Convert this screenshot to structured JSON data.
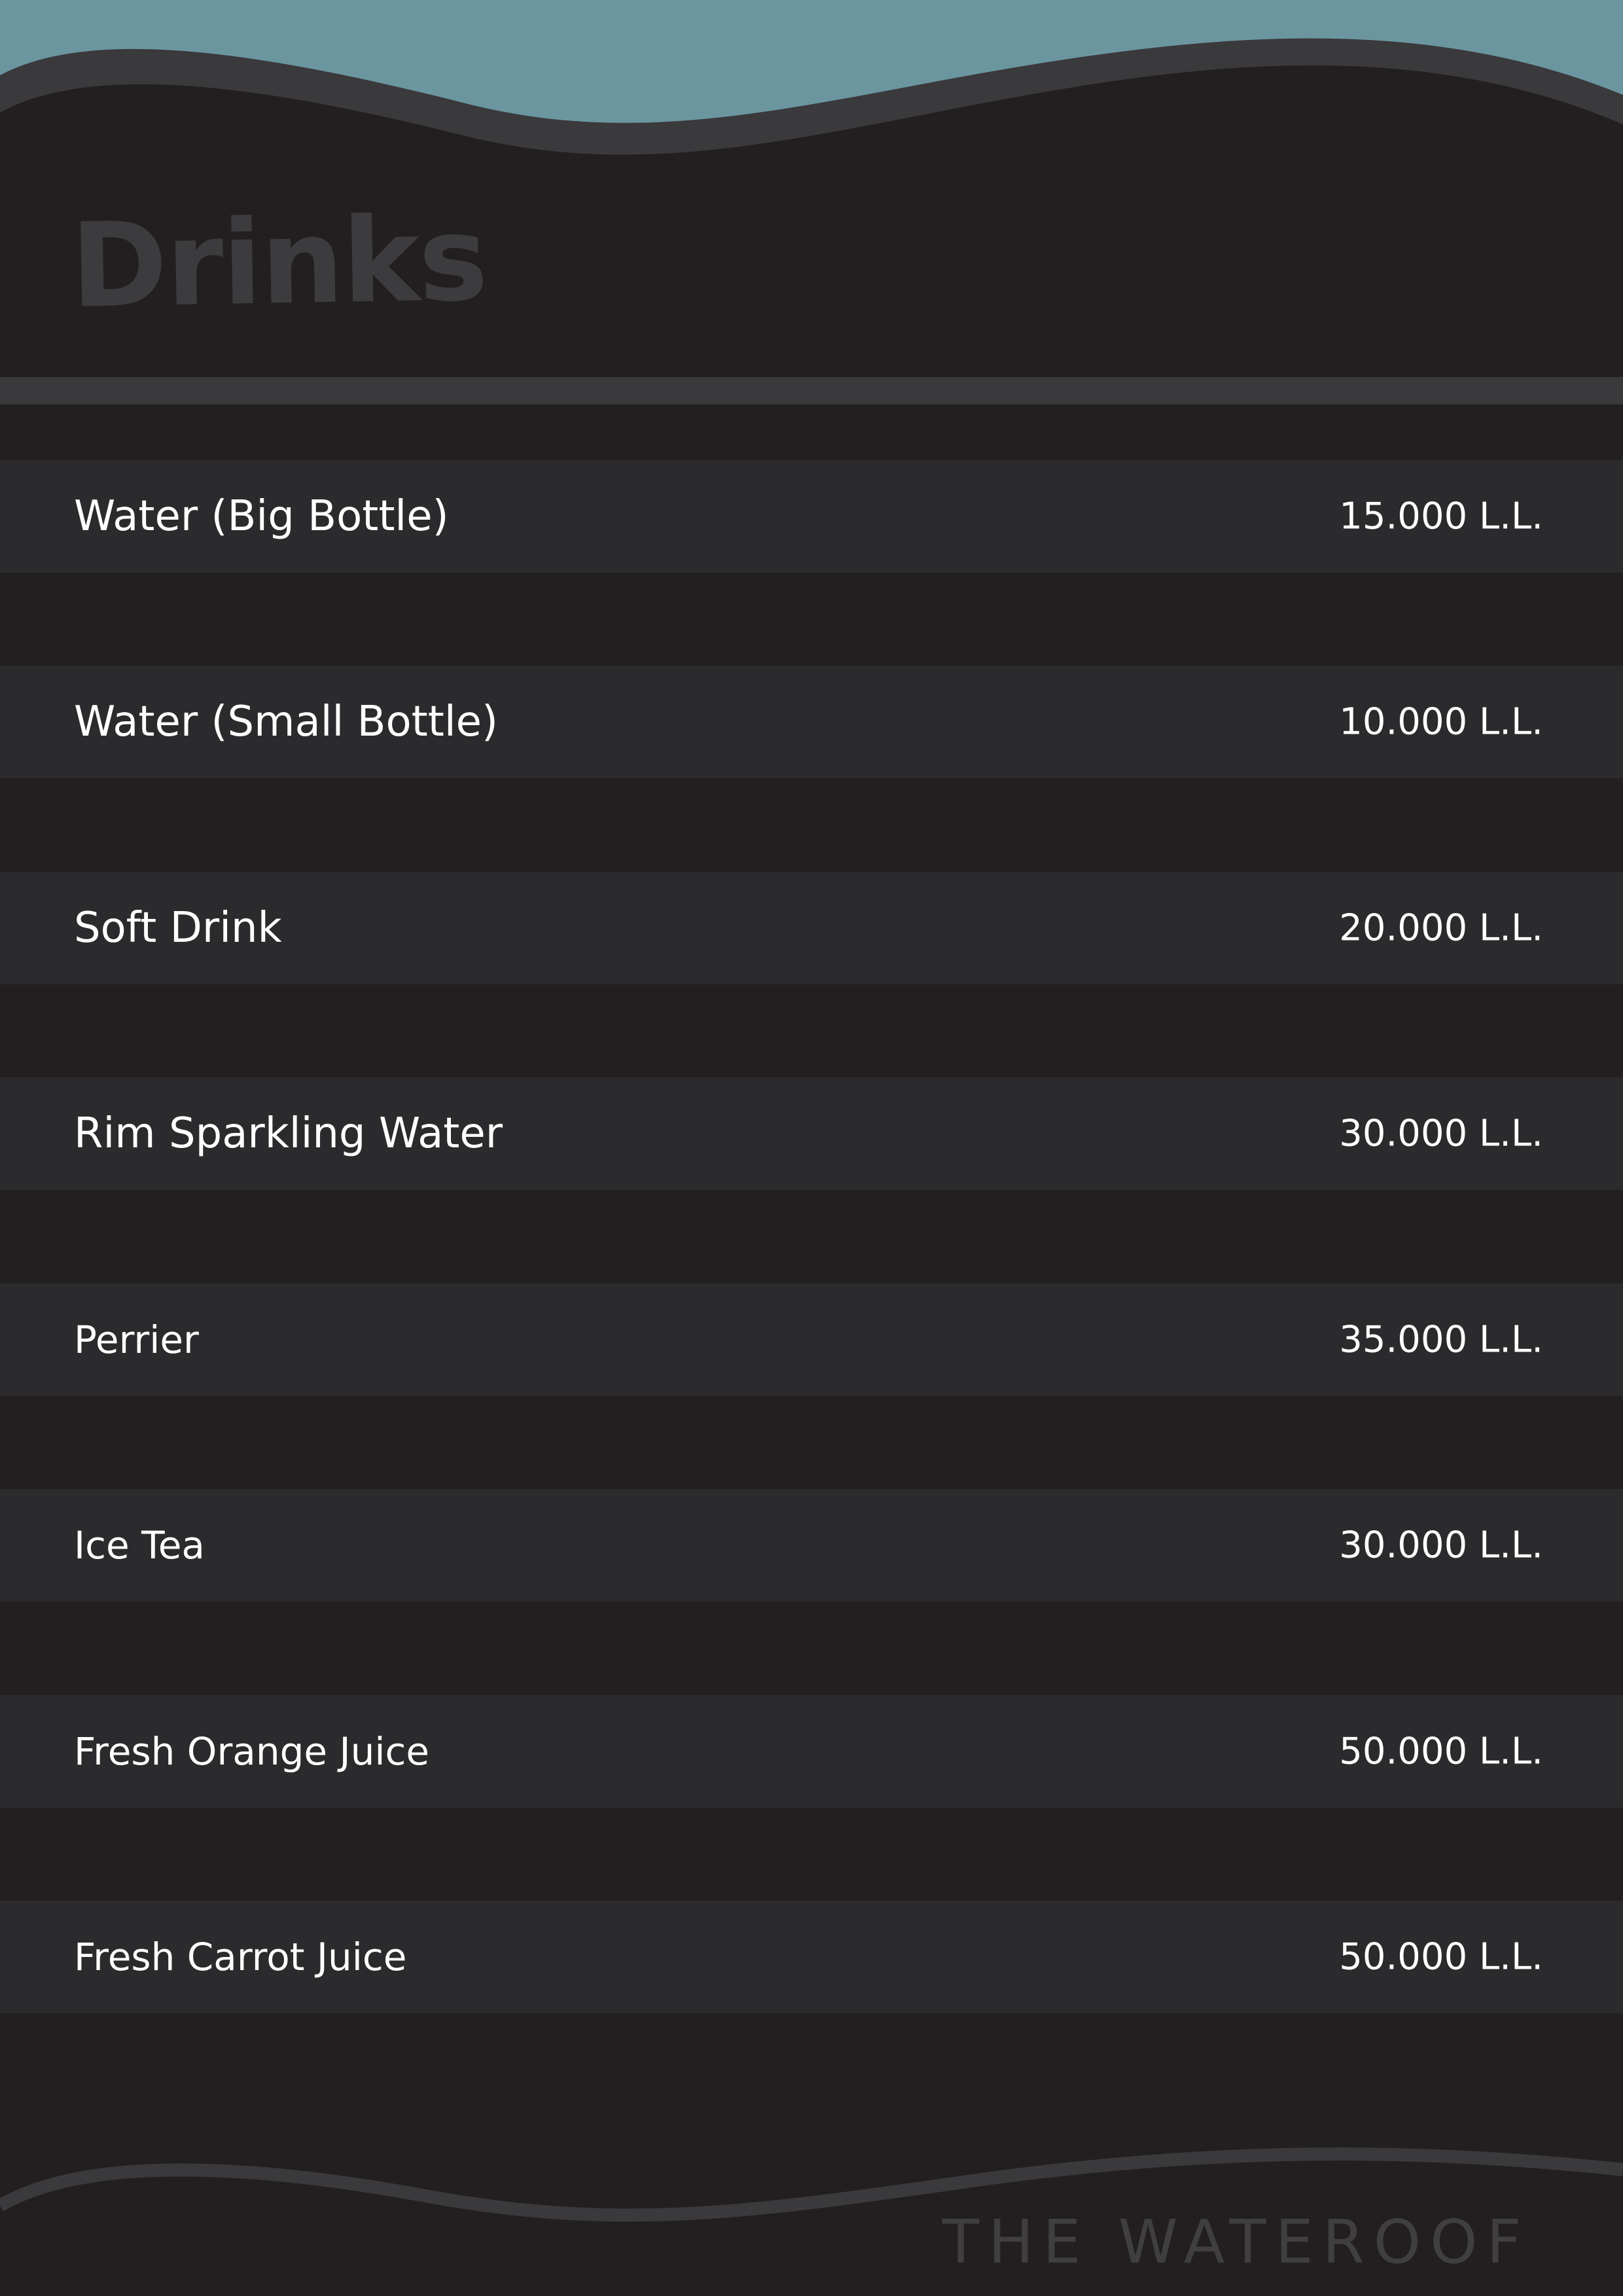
{
  "menu": {
    "title": "Drinks",
    "items": [
      {
        "name": "Water (Big Bottle)",
        "price": "15.000 L.L."
      },
      {
        "name": "Water (Small Bottle)",
        "price": "10.000 L.L."
      },
      {
        "name": "Soft Drink",
        "price": "20.000 L.L."
      },
      {
        "name": "Rim Sparkling Water",
        "price": "30.000 L.L."
      },
      {
        "name": "Perrier",
        "price": "35.000 L.L."
      },
      {
        "name": "Ice Tea",
        "price": "30.000 L.L."
      },
      {
        "name": "Fresh Orange Juice",
        "price": "50.000 L.L."
      },
      {
        "name": "Fresh Carrot Juice",
        "price": "50.000 L.L."
      }
    ]
  },
  "footer": {
    "brand": "THE WATEROOF"
  },
  "colors": {
    "background": "#231f20",
    "sky": "#6b96a0",
    "wave_band": "#3a393c",
    "row": "#2b2a2c",
    "title": "#3c3b3e",
    "text": "#ffffff"
  }
}
